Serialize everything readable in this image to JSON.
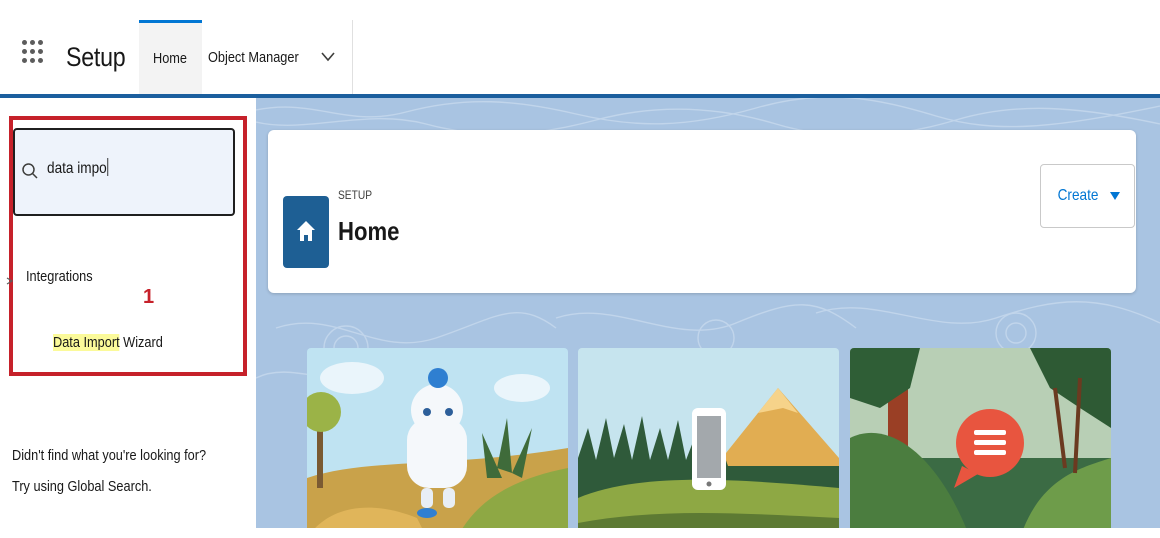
{
  "topbar": {
    "app_title": "Setup",
    "tabs": [
      {
        "label": "Home",
        "active": true
      },
      {
        "label": "Object Manager",
        "active": false
      }
    ]
  },
  "sidebar": {
    "search": {
      "value": "data impo"
    },
    "category": "Integrations",
    "annotation_number": "1",
    "result": {
      "highlight": "Data Import",
      "rest": " Wizard"
    },
    "not_found_line1": "Didn't find what you're looking for?",
    "not_found_line2": "Try using Global Search."
  },
  "header": {
    "eyebrow": "SETUP",
    "title": "Home",
    "create_label": "Create"
  },
  "icons": {
    "launcher": "app-launcher-icon",
    "search": "search-icon",
    "home": "home-icon",
    "chevron": "chevron-down-icon",
    "dropdown": "caret-down-icon"
  },
  "colors": {
    "brand_blue": "#0176d3",
    "nav_line": "#1b5f9e",
    "highlight_box": "#c6212a",
    "search_highlight": "#fbfa9a",
    "home_tile": "#1e5f94"
  }
}
